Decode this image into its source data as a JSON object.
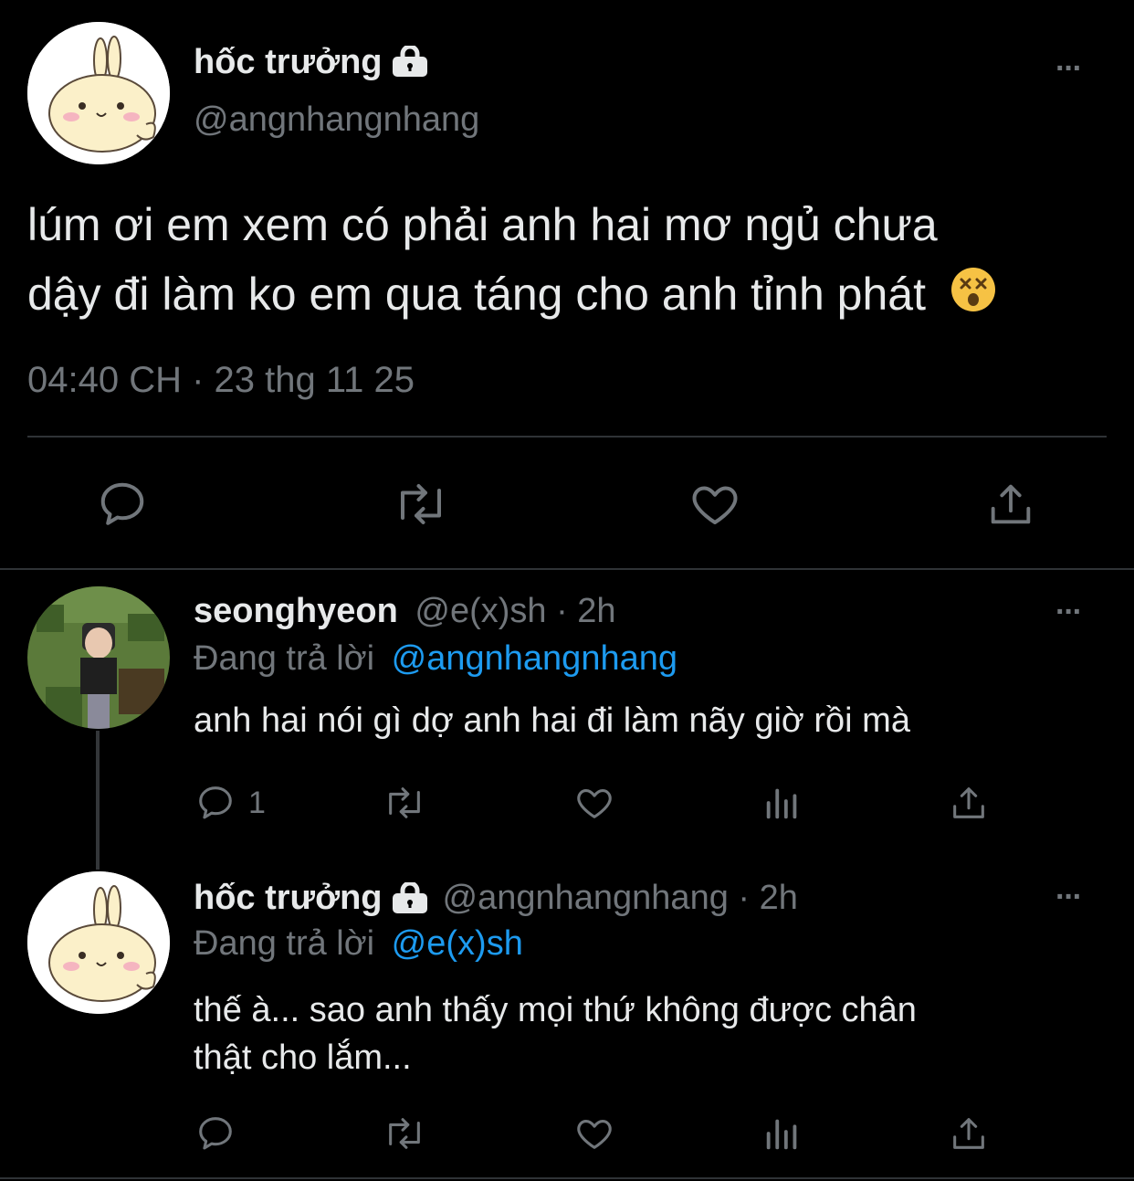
{
  "main_tweet": {
    "display_name": "hốc trưởng",
    "handle": "@angnhangnhang",
    "text_line1": "lúm ơi em xem có phải anh hai mơ ngủ chưa",
    "text_line2": "dậy đi làm ko em qua táng cho anh tỉnh phát",
    "emoji": "😵",
    "timestamp": "04:40 CH · 23 thg 11 25",
    "more_label": "···"
  },
  "replies": [
    {
      "display_name": "seonghyeon",
      "meta": "@e(x)sh · 2h",
      "replying_prefix": "Đang trả lời",
      "replying_to": "@angnhangnhang",
      "text_line1": "anh hai nói gì dợ anh hai đi làm nãy giờ rồi mà",
      "text_line2": "",
      "reply_count": "1",
      "more_label": "···"
    },
    {
      "display_name": "hốc trưởng",
      "meta": "@angnhangnhang · 2h",
      "replying_prefix": "Đang trả lời",
      "replying_to": "@e(x)sh",
      "text_line1": "thế à... sao anh thấy mọi thứ không được chân",
      "text_line2": "thật cho lắm...",
      "reply_count": "",
      "more_label": "···"
    }
  ],
  "colors": {
    "background": "#000000",
    "text": "#e7e9ea",
    "muted": "#71767b",
    "link": "#1d9bf0",
    "divider": "#2f3336"
  }
}
